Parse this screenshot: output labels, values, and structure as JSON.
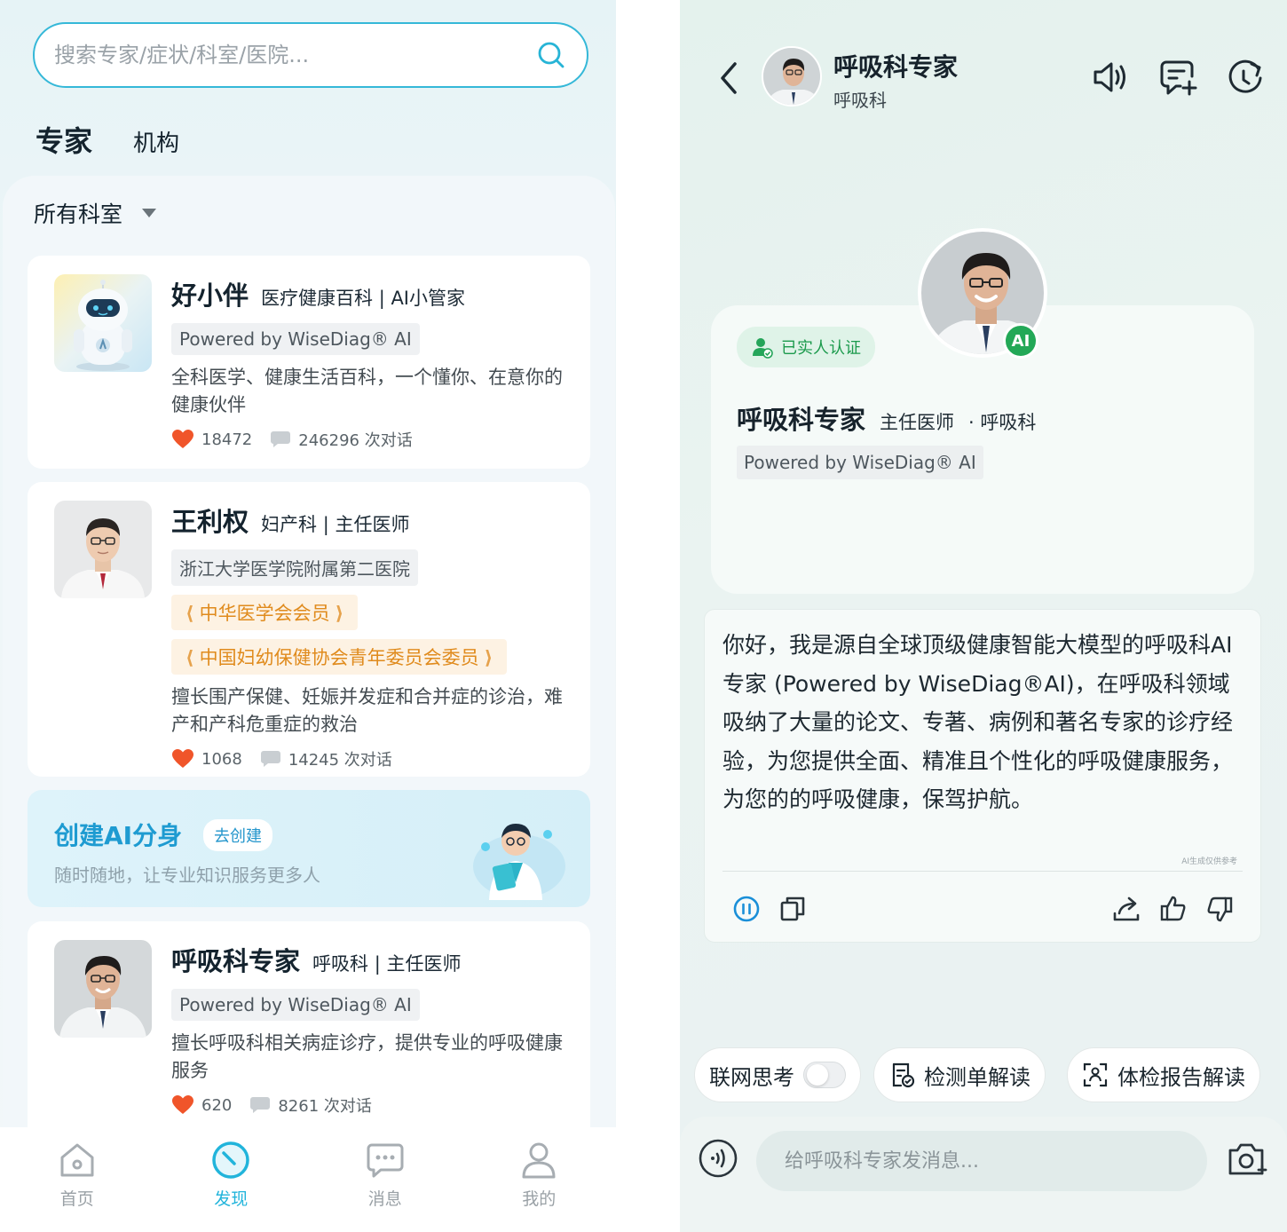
{
  "left": {
    "search": {
      "placeholder": "搜索专家/症状/科室/医院..."
    },
    "tabs": {
      "active": "专家",
      "other": "机构"
    },
    "dept_filter": "所有科室",
    "cards": [
      {
        "name": "好小伴",
        "subtitle": "医疗健康百科 | AI小管家",
        "tags": [
          "Powered by WiseDiag® AI"
        ],
        "desc": "全科医学、健康生活百科，一个懂你、在意你的健康伙伴",
        "likes": "18472",
        "chats": "246296 次对话"
      },
      {
        "name": "王利权",
        "subtitle": "妇产科 | 主任医师",
        "tags": [
          "浙江大学医学院附属第二医院"
        ],
        "honors": [
          "中华医学会会员",
          "中国妇幼保健协会青年委员会委员"
        ],
        "desc": "擅长围产保健、妊娠并发症和合并症的诊治，难产和产科危重症的救治",
        "likes": "1068",
        "chats": "14245 次对话"
      },
      {
        "name": "呼吸科专家",
        "subtitle": "呼吸科 | 主任医师",
        "tags": [
          "Powered by WiseDiag® AI"
        ],
        "desc": "擅长呼吸科相关病症诊疗，提供专业的呼吸健康服务",
        "likes": "620",
        "chats": "8261 次对话"
      }
    ],
    "banner": {
      "title": "创建AI分身",
      "button": "去创建",
      "subtitle": "随时随地，让专业知识服务更多人"
    },
    "nav": [
      {
        "label": "首页",
        "icon": "home-icon"
      },
      {
        "label": "发现",
        "icon": "discover-icon"
      },
      {
        "label": "消息",
        "icon": "message-icon"
      },
      {
        "label": "我的",
        "icon": "profile-icon"
      }
    ],
    "colors": {
      "accent": "#21b4db",
      "like": "#f0552a"
    }
  },
  "right": {
    "header": {
      "title": "呼吸科专家",
      "subtitle": "呼吸科"
    },
    "profile": {
      "verified": "已实人认证",
      "ai_badge": "AI",
      "name": "呼吸科专家",
      "title": "主任医师",
      "dept": "· 呼吸科",
      "tag": "Powered by WiseDiag® AI"
    },
    "message": {
      "text": "你好，我是源自全球顶级健康智能大模型的呼吸科AI专家 (Powered by WiseDiag®AI)，在呼吸科领域吸纳了大量的论文、专著、病例和著名专家的诊疗经验，为您提供全面、精准且个性化的呼吸健康服务，为您的的呼吸健康，保驾护航。",
      "note": "AI生成仅供参考"
    },
    "quick_actions": {
      "web_think": "联网思考",
      "lab_report": "检测单解读",
      "checkup_report": "体检报告解读"
    },
    "input": {
      "placeholder": "给呼吸科专家发消息..."
    },
    "colors": {
      "verified": "#1b9a4c",
      "action_blue": "#1a8fd8"
    }
  }
}
